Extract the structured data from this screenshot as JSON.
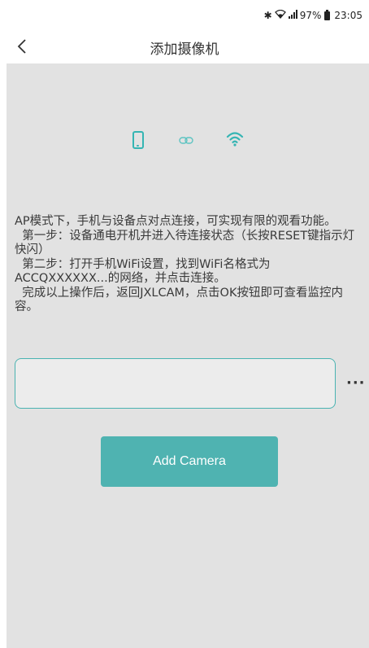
{
  "status_bar": {
    "signal_text": "97%",
    "time": "23:05",
    "icons": [
      "bluetooth-icon",
      "wifi-signal-icon",
      "cell-signal-icon",
      "battery-icon"
    ]
  },
  "nav": {
    "title": "添加摄像机",
    "back_icon": "chevron-left-icon"
  },
  "connection_icons": [
    "phone-icon",
    "link-icon",
    "wifi-icon"
  ],
  "accent_color": "#4fb3b1",
  "instructions": {
    "line1": "AP模式下，手机与设备点对点连接，可实现有限的观看功能。",
    "line2": "  第一步：设备通电开机并进入待连接状态（长按RESET键指示灯快闪）",
    "line3": "  第二步：打开手机WiFi设置，找到WiFi名格式为ACCQXXXXXX...的网络，并点击连接。",
    "line4": "  完成以上操作后，返回JXLCAM，点击OK按钮即可查看监控内容。"
  },
  "input": {
    "value": "",
    "placeholder": "",
    "more_label": "···"
  },
  "add_camera_button": {
    "label": "Add Camera"
  }
}
